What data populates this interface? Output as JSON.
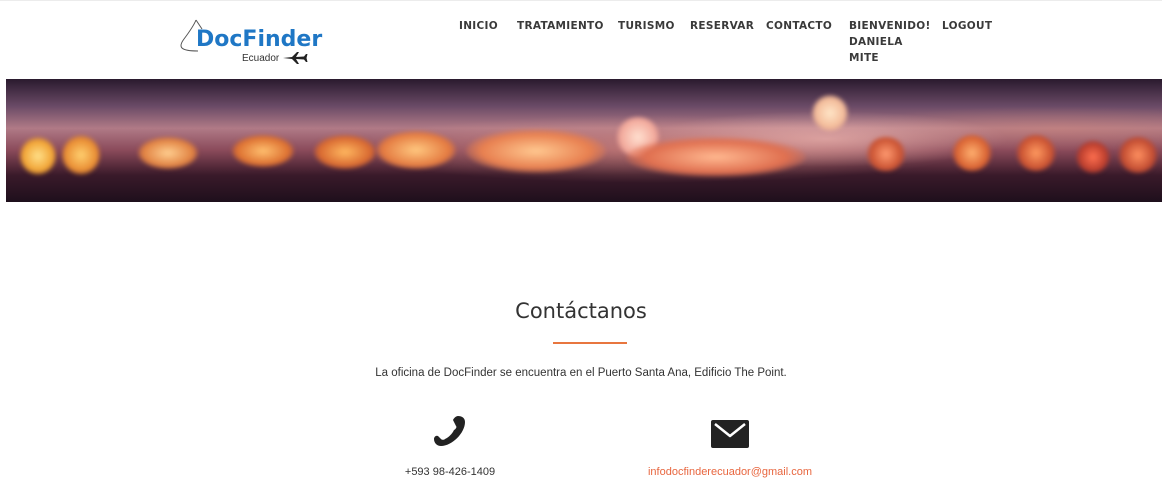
{
  "header": {
    "logo": {
      "title": "DocFinder",
      "subtitle": "Ecuador"
    },
    "nav": {
      "inicio": "INICIO",
      "tratamiento": "TRATAMIENTO",
      "turismo": "TURISMO",
      "reservar": "RESERVAR",
      "contacto": "CONTACTO",
      "welcome_line1": "BIENVENIDO!",
      "welcome_line2": "DANIELA",
      "welcome_line3": "MITE",
      "logout": "LOGOUT"
    }
  },
  "contact": {
    "title": "Contáctanos",
    "description": "La oficina de DocFinder se encuentra en el Puerto Santa Ana, Edificio The Point.",
    "phone": "+593 98-426-1409",
    "email": "infodocfinderecuador@gmail.com"
  },
  "icons": {
    "phone": "phone-icon",
    "mail": "envelope-icon",
    "plane": "airplane-icon"
  },
  "colors": {
    "brand_blue": "#1f77c5",
    "accent_orange": "#e8763f",
    "email_link": "#e8663f",
    "icon_dark": "#222222"
  }
}
